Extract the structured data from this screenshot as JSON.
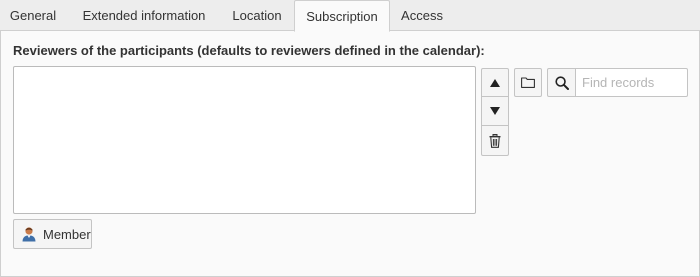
{
  "tabs": [
    {
      "label": "General",
      "active": false
    },
    {
      "label": "Extended information",
      "active": false
    },
    {
      "label": "Location",
      "active": false
    },
    {
      "label": "Subscription",
      "active": true
    },
    {
      "label": "Access",
      "active": false
    }
  ],
  "field": {
    "label": "Reviewers of the participants (defaults to reviewers defined in the calendar):",
    "records": []
  },
  "search": {
    "placeholder": "Find records",
    "value": ""
  },
  "member_button": {
    "label": "Member"
  },
  "icons": {
    "move_up": "triangle-up-icon",
    "move_down": "triangle-down-icon",
    "delete": "trash-icon",
    "browse": "folder-icon",
    "search": "magnifier-icon",
    "member": "user-icon"
  },
  "colors": {
    "tab_bar": "#ededed",
    "panel": "#fafafa",
    "border": "#cfcfcf",
    "button": "#f5f5f5",
    "user_icon": "#c97b4a"
  }
}
